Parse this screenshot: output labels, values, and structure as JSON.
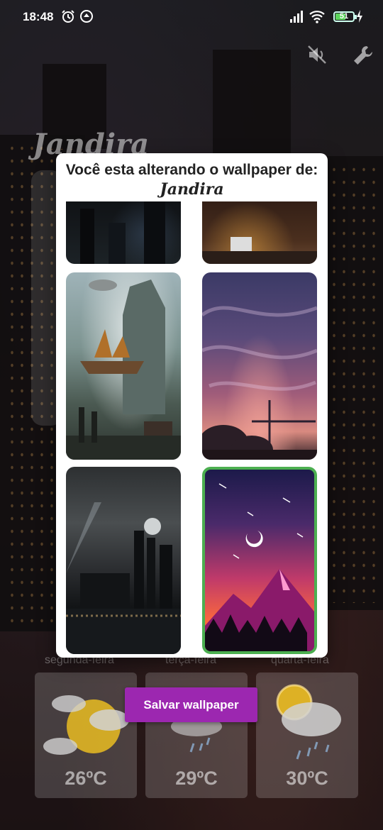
{
  "status_bar": {
    "time": "18:48",
    "battery_level": "51",
    "icons": [
      "alarm-icon",
      "focus-icon",
      "signal-icon",
      "wifi-icon",
      "battery-icon",
      "charging-icon"
    ]
  },
  "toolbar": {
    "mute_icon": "volume-off-icon",
    "settings_icon": "wrench-icon"
  },
  "app": {
    "title": "Jandira"
  },
  "modal": {
    "heading": "Você esta alterando o wallpaper de:",
    "subject": "Jandira",
    "wallpapers": [
      {
        "name": "city-night-dark"
      },
      {
        "name": "city-dusk-street"
      },
      {
        "name": "steampunk-airship-city"
      },
      {
        "name": "purple-sky-crane"
      },
      {
        "name": "night-city-skyline"
      },
      {
        "name": "synthwave-mountains",
        "selected": true
      }
    ]
  },
  "forecast": {
    "days": [
      {
        "label": "segunda-feira",
        "temp": "26ºC",
        "icon": "partly-cloudy-icon"
      },
      {
        "label": "terça-feira",
        "temp": "29ºC",
        "icon": "rain-icon"
      },
      {
        "label": "quarta-feira",
        "temp": "30ºC",
        "icon": "sun-rain-icon"
      }
    ]
  },
  "actions": {
    "save_label": "Salvar wallpaper"
  },
  "colors": {
    "accent": "#9c27b0",
    "selected_border": "#4caf50"
  }
}
